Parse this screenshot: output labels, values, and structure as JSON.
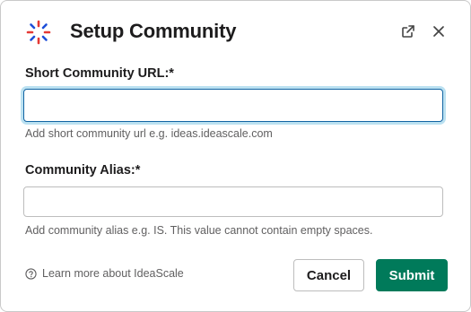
{
  "dialog": {
    "title": "Setup Community",
    "header_icons": [
      "open-external-icon",
      "close-icon"
    ]
  },
  "fields": {
    "url": {
      "label": "Short Community URL:*",
      "value": "",
      "placeholder": "",
      "hint": "Add short community url e.g. ideas.ideascale.com"
    },
    "alias": {
      "label": "Community Alias:*",
      "value": "",
      "placeholder": "",
      "hint": "Add community alias e.g. IS. This value cannot contain empty spaces."
    }
  },
  "footer": {
    "learn_more": "Learn more about IdeaScale",
    "cancel_label": "Cancel",
    "submit_label": "Submit"
  },
  "colors": {
    "submit_bg": "#007a5a",
    "focus_border": "#1264a3",
    "logo_blue": "#1d4ed8",
    "logo_red": "#e53935"
  }
}
